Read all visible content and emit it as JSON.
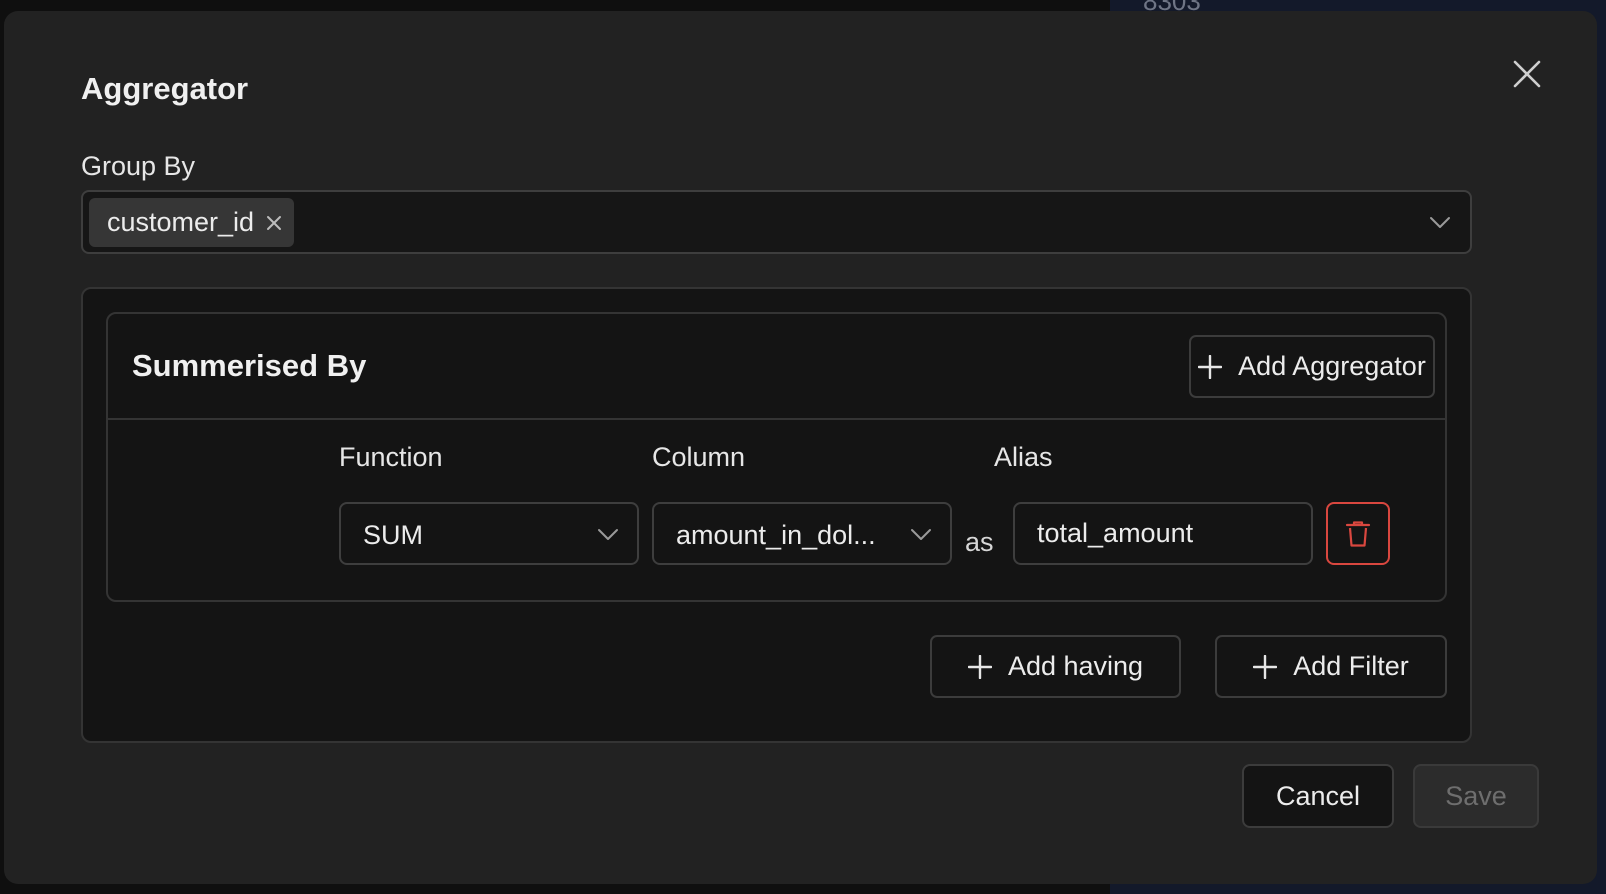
{
  "background": {
    "partial_text": "8303"
  },
  "modal": {
    "title": "Aggregator",
    "close_icon": "close-icon"
  },
  "group_by": {
    "label": "Group By",
    "tags": [
      "customer_id"
    ],
    "tag_remove_icon": "close-icon",
    "dropdown_icon": "chevron-down-icon"
  },
  "summarised_by": {
    "title": "Summerised By",
    "add_aggregator_label": "Add Aggregator",
    "add_icon": "plus-icon",
    "columns": {
      "function_label": "Function",
      "column_label": "Column",
      "alias_label": "Alias"
    },
    "row": {
      "function_value": "SUM",
      "column_value": "amount_in_dol...",
      "as_text": "as",
      "alias_value": "total_amount",
      "delete_icon": "trash-icon",
      "delete_color": "#d9473f"
    }
  },
  "actions": {
    "add_having_label": "Add having",
    "add_filter_label": "Add Filter"
  },
  "footer": {
    "cancel_label": "Cancel",
    "save_label": "Save",
    "save_disabled": true
  }
}
